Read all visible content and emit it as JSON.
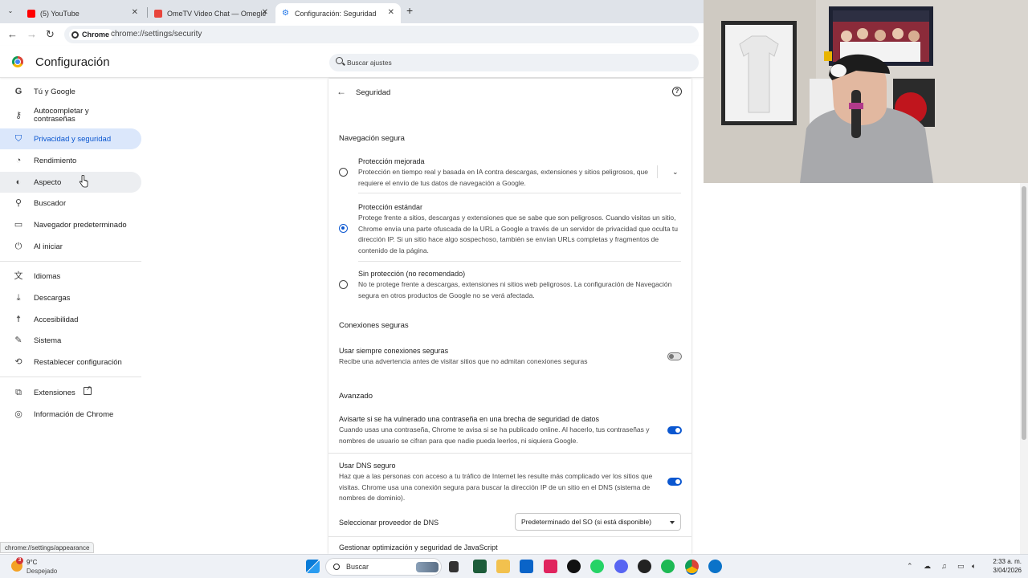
{
  "tabs": [
    {
      "title": "(5) YouTube",
      "color": "#ff0000"
    },
    {
      "title": "OmeTV Video Chat — Omegle",
      "color": "#e8453c"
    },
    {
      "title": "Configuración: Seguridad",
      "color": "#1a73e8"
    }
  ],
  "toolbar": {
    "chip_label": "Chrome",
    "url": "chrome://settings/security"
  },
  "header": {
    "title": "Configuración",
    "search_placeholder": "Buscar ajustes"
  },
  "sidebar": {
    "items": [
      {
        "label": "Tú y Google",
        "icon": "google-icon"
      },
      {
        "label": "Autocompletar y contraseñas",
        "icon": "key-icon"
      },
      {
        "label": "Privacidad y seguridad",
        "icon": "shield-icon"
      },
      {
        "label": "Rendimiento",
        "icon": "gauge-icon"
      },
      {
        "label": "Aspecto",
        "icon": "palette-icon"
      },
      {
        "label": "Buscador",
        "icon": "search-icon"
      },
      {
        "label": "Navegador predeterminado",
        "icon": "browser-icon"
      },
      {
        "label": "Al iniciar",
        "icon": "power-icon"
      },
      {
        "label": "Idiomas",
        "icon": "translate-icon"
      },
      {
        "label": "Descargas",
        "icon": "download-icon"
      },
      {
        "label": "Accesibilidad",
        "icon": "accessibility-icon"
      },
      {
        "label": "Sistema",
        "icon": "wrench-icon"
      },
      {
        "label": "Restablecer configuración",
        "icon": "reset-icon"
      },
      {
        "label": "Extensiones",
        "icon": "puzzle-icon"
      },
      {
        "label": "Información de Chrome",
        "icon": "chrome-icon"
      }
    ]
  },
  "main": {
    "title": "Seguridad",
    "safe_browsing": {
      "heading": "Navegación segura",
      "options": [
        {
          "title": "Protección mejorada",
          "desc": "Protección en tiempo real y basada en IA contra descargas, extensiones y sitios peligrosos, que requiere el envío de tus datos de navegación a Google.",
          "selected": false
        },
        {
          "title": "Protección estándar",
          "desc": "Protege frente a sitios, descargas y extensiones que se sabe que son peligrosos. Cuando visitas un sitio, Chrome envía una parte ofuscada de la URL a Google a través de un servidor de privacidad que oculta tu dirección IP. Si un sitio hace algo sospechoso, también se envían URLs completas y fragmentos de contenido de la página.",
          "selected": true
        },
        {
          "title": "Sin protección (no recomendado)",
          "desc": "No te protege frente a descargas, extensiones ni sitios web peligrosos. La configuración de Navegación segura en otros productos de Google no se verá afectada.",
          "selected": false
        }
      ]
    },
    "secure_connections": {
      "heading": "Conexiones seguras",
      "title": "Usar siempre conexiones seguras",
      "desc": "Recibe una advertencia antes de visitar sitios que no admitan conexiones seguras",
      "enabled": false
    },
    "advanced": {
      "heading": "Avanzado",
      "password_alert": {
        "title": "Avisarte si se ha vulnerado una contraseña en una brecha de seguridad de datos",
        "desc": "Cuando usas una contraseña, Chrome te avisa si se ha publicado online. Al hacerlo, tus contraseñas y nombres de usuario se cifran para que nadie pueda leerlos, ni siquiera Google.",
        "enabled": true
      },
      "secure_dns": {
        "title": "Usar DNS seguro",
        "desc": "Haz que a las personas con acceso a tu tráfico de Internet les resulte más complicado ver los sitios que visitas. Chrome usa una conexión segura para buscar la dirección IP de un sitio en el DNS (sistema de nombres de dominio).",
        "enabled": true
      },
      "dns_provider": {
        "label": "Seleccionar proveedor de DNS",
        "value": "Predeterminado del SO (si está disponible)"
      },
      "js_row": "Gestionar optimización y seguridad de JavaScript"
    }
  },
  "status_url": "chrome://settings/appearance",
  "taskbar": {
    "weather_badge": "3",
    "temperature": "9°C",
    "condition": "Despejado",
    "search_label": "Buscar",
    "time": "2:33 a. m.",
    "date": "3/04/2026"
  }
}
